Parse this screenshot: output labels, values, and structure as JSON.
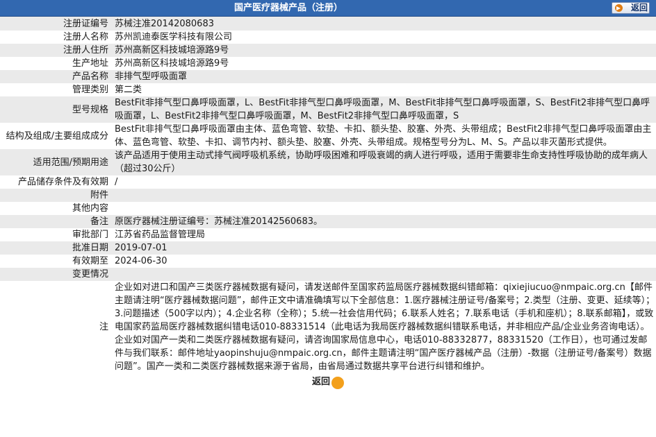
{
  "header": {
    "title": "国产医疗器械产品（注册）",
    "back_label": "返回"
  },
  "rows": [
    {
      "label": "注册证编号",
      "value": "苏械注准20142080683"
    },
    {
      "label": "注册人名称",
      "value": "苏州凯迪泰医学科技有限公司"
    },
    {
      "label": "注册人住所",
      "value": "苏州高新区科技城培源路9号"
    },
    {
      "label": "生产地址",
      "value": "苏州高新区科技城培源路9号"
    },
    {
      "label": "产品名称",
      "value": "非排气型呼吸面罩"
    },
    {
      "label": "管理类别",
      "value": "第二类"
    },
    {
      "label": "型号规格",
      "value": "BestFit非排气型口鼻呼吸面罩，L、BestFit非排气型口鼻呼吸面罩，M、BestFit非排气型口鼻呼吸面罩，S、BestFit2非排气型口鼻呼吸面罩，L、BestFit2非排气型口鼻呼吸面罩，M、BestFit2非排气型口鼻呼吸面罩，S"
    },
    {
      "label": "结构及组成/主要组成成分",
      "value": "BestFit非排气型口鼻呼吸面罩由主体、蓝色弯管、软垫、卡扣、额头垫、胶塞、外壳、头带组成；BestFit2非排气型口鼻呼吸面罩由主体、蓝色弯管、软垫、卡扣、调节内衬、额头垫、胶塞、外壳、头带组成。规格型号分为L、M、S。产品以非灭菌形式提供。"
    },
    {
      "label": "适用范围/预期用途",
      "value": "该产品适用于使用主动式排气阀呼吸机系统，协助呼吸困难和呼吸衰竭的病人进行呼吸，适用于需要非生命支持性呼吸协助的成年病人（超过30公斤）"
    },
    {
      "label": "产品储存条件及有效期",
      "value": "/"
    },
    {
      "label": "附件",
      "value": ""
    },
    {
      "label": "其他内容",
      "value": ""
    },
    {
      "label": "备注",
      "value": "原医疗器械注册证编号：苏械注准20142560683。"
    },
    {
      "label": "审批部门",
      "value": "江苏省药品监督管理局"
    },
    {
      "label": "批准日期",
      "value": "2019-07-01"
    },
    {
      "label": "有效期至",
      "value": "2024-06-30"
    },
    {
      "label": "变更情况",
      "value": ""
    },
    {
      "label": "注",
      "value": "企业如对进口和国产三类医疗器械数据有疑问，请发送邮件至国家药监局医疗器械数据纠错邮箱：qixiejiucuo@nmpaic.org.cn【邮件主题请注明“医疗器械数据问题”，邮件正文中请准确填写以下全部信息：1.医疗器械注册证号/备案号；2.类型（注册、变更、延续等）；3.问题描述（500字以内）；4.企业名称（全称）；5.统一社会信用代码；6.联系人姓名；7.联系电话（手机和座机）；8.联系邮箱】，或致电国家药监局医疗器械数据纠错电话010-88331514（此电话为我局医疗器械数据纠错联系电话，并非相应产品/企业业务咨询电话）。企业如对国产一类和二类医疗器械数据有疑问，请咨询国家局信息中心，电话010-88332877，88331520（工作日），也可通过发邮件与我们联系：邮件地址yaopinshuju@nmpaic.org.cn，邮件主题请注明“国产医疗器械产品（注册）-数据（注册证号/备案号）数据问题”。国产一类和二类医疗器械数据来源于省局，由省局通过数据共享平台进行纠错和维护。"
    }
  ],
  "footer": {
    "back_label": "返回"
  }
}
